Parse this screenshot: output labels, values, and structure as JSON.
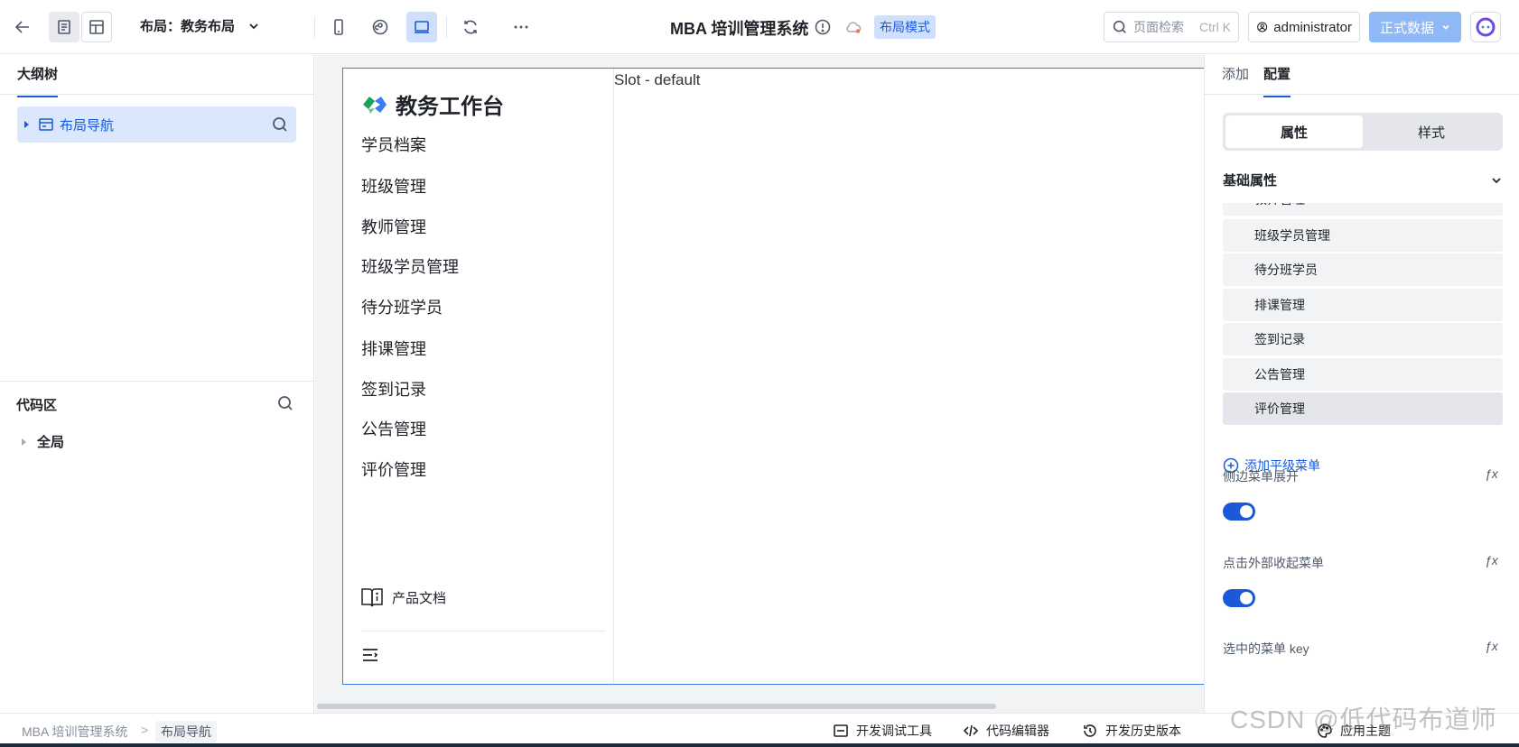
{
  "topbar": {
    "layout_label": "布局：教务布局",
    "app_title": "MBA 培训管理系统",
    "mode_badge": "布局模式",
    "search_placeholder": "页面检索",
    "search_shortcut": "Ctrl K",
    "user_name": "administrator",
    "data_button": "正式数据"
  },
  "left_panel": {
    "tab_label": "大纲树",
    "tree_node_label": "布局导航",
    "code_title": "代码区",
    "code_node_label": "全局"
  },
  "canvas": {
    "brand": "教务工作台",
    "nav_items": [
      "学员档案",
      "班级管理",
      "教师管理",
      "班级学员管理",
      "待分班学员",
      "排课管理",
      "签到记录",
      "公告管理",
      "评价管理"
    ],
    "doc_link": "产品文档",
    "slot_label": "Slot - default"
  },
  "right_panel": {
    "tab_add": "添加",
    "tab_config": "配置",
    "seg_props": "属性",
    "seg_style": "样式",
    "section_title": "基础属性",
    "menu_rows": [
      "教师管理",
      "班级学员管理",
      "待分班学员",
      "排课管理",
      "签到记录",
      "公告管理",
      "评价管理"
    ],
    "add_menu": "添加平级菜单",
    "prop_sidebar_expand": "侧边菜单展开",
    "prop_click_outside": "点击外部收起菜单",
    "prop_selected_key": "选中的菜单 key",
    "fx_label": "ƒx",
    "sidebar_expand_on": true,
    "click_outside_on": true
  },
  "bottombar": {
    "crumb_app": "MBA 培训管理系统",
    "crumb_sep": ">",
    "crumb_current": "布局导航",
    "tool_debug": "开发调试工具",
    "tool_code": "代码编辑器",
    "tool_history": "开发历史版本",
    "tool_theme": "应用主题"
  },
  "watermark": "CSDN @低代码布道师",
  "colors": {
    "accent": "#1a5ad9",
    "selected_bg": "#dbe7fd",
    "canvas_bg": "#f2f3f5",
    "data_button_bg": "#8fb8f7"
  }
}
